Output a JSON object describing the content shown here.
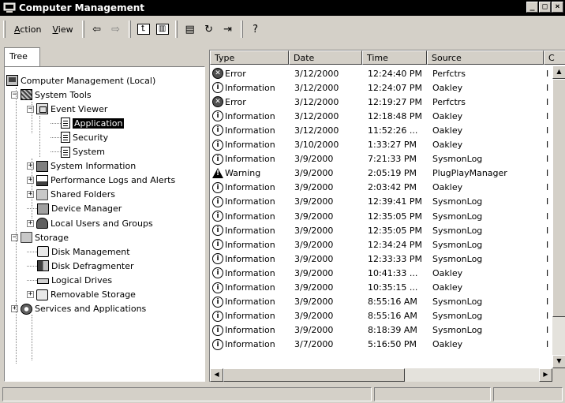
{
  "window": {
    "title": "Computer Management"
  },
  "title_buttons": [
    "_",
    "□",
    "×"
  ],
  "menu": [
    {
      "label": "Action",
      "accel": "A",
      "rest": "ction"
    },
    {
      "label": "View",
      "accel": "V",
      "rest": "iew"
    }
  ],
  "toolbar": {
    "icons": [
      "back-arrow-icon",
      "forward-arrow-icon",
      "up-folder-icon",
      "show-hide-tree-icon",
      "properties-icon",
      "refresh-icon",
      "export-list-icon",
      "help-icon"
    ],
    "glyphs": {
      "back": "⇦",
      "forward": "⇨",
      "up": "⮤",
      "tree": "▥",
      "props": "▤",
      "refresh": "↻",
      "export": "⇥",
      "help": "?"
    }
  },
  "tree": {
    "tab_label": "Tree",
    "items": [
      {
        "label": "Computer Management (Local)",
        "icon": "computer-icon",
        "expander": ""
      },
      {
        "label": "System Tools",
        "icon": "tools-icon",
        "expander": "−"
      },
      {
        "label": "Event Viewer",
        "icon": "event-viewer-icon",
        "expander": "−"
      },
      {
        "label": "Application",
        "icon": "log-icon",
        "expander": "",
        "selected": true
      },
      {
        "label": "Security",
        "icon": "log-icon",
        "expander": ""
      },
      {
        "label": "System",
        "icon": "log-icon",
        "expander": ""
      },
      {
        "label": "System Information",
        "icon": "system-info-icon",
        "expander": "+"
      },
      {
        "label": "Performance Logs and Alerts",
        "icon": "performance-icon",
        "expander": "+"
      },
      {
        "label": "Shared Folders",
        "icon": "shared-folder-icon",
        "expander": "+"
      },
      {
        "label": "Device Manager",
        "icon": "device-manager-icon",
        "expander": ""
      },
      {
        "label": "Local Users and Groups",
        "icon": "users-icon",
        "expander": "+"
      },
      {
        "label": "Storage",
        "icon": "storage-icon",
        "expander": "−"
      },
      {
        "label": "Disk Management",
        "icon": "disk-icon",
        "expander": ""
      },
      {
        "label": "Disk Defragmenter",
        "icon": "defrag-icon",
        "expander": ""
      },
      {
        "label": "Logical Drives",
        "icon": "drive-icon",
        "expander": ""
      },
      {
        "label": "Removable Storage",
        "icon": "removable-storage-icon",
        "expander": "+"
      },
      {
        "label": "Services and Applications",
        "icon": "services-icon",
        "expander": "+"
      }
    ]
  },
  "list": {
    "columns": [
      "Type",
      "Date",
      "Time",
      "Source",
      "C"
    ],
    "rows": [
      {
        "type": "Error",
        "date": "3/12/2000",
        "time": "12:24:40 PM",
        "source": "Perfctrs",
        "extra": "I"
      },
      {
        "type": "Information",
        "date": "3/12/2000",
        "time": "12:24:07 PM",
        "source": "Oakley",
        "extra": "I"
      },
      {
        "type": "Error",
        "date": "3/12/2000",
        "time": "12:19:27 PM",
        "source": "Perfctrs",
        "extra": "I"
      },
      {
        "type": "Information",
        "date": "3/12/2000",
        "time": "12:18:48 PM",
        "source": "Oakley",
        "extra": "I"
      },
      {
        "type": "Information",
        "date": "3/12/2000",
        "time": "11:52:26 ...",
        "source": "Oakley",
        "extra": "I"
      },
      {
        "type": "Information",
        "date": "3/10/2000",
        "time": "1:33:27 PM",
        "source": "Oakley",
        "extra": "I"
      },
      {
        "type": "Information",
        "date": "3/9/2000",
        "time": "7:21:33 PM",
        "source": "SysmonLog",
        "extra": "I"
      },
      {
        "type": "Warning",
        "date": "3/9/2000",
        "time": "2:05:19 PM",
        "source": "PlugPlayManager",
        "extra": "I"
      },
      {
        "type": "Information",
        "date": "3/9/2000",
        "time": "2:03:42 PM",
        "source": "Oakley",
        "extra": "I"
      },
      {
        "type": "Information",
        "date": "3/9/2000",
        "time": "12:39:41 PM",
        "source": "SysmonLog",
        "extra": "I"
      },
      {
        "type": "Information",
        "date": "3/9/2000",
        "time": "12:35:05 PM",
        "source": "SysmonLog",
        "extra": "I"
      },
      {
        "type": "Information",
        "date": "3/9/2000",
        "time": "12:35:05 PM",
        "source": "SysmonLog",
        "extra": "I"
      },
      {
        "type": "Information",
        "date": "3/9/2000",
        "time": "12:34:24 PM",
        "source": "SysmonLog",
        "extra": "I"
      },
      {
        "type": "Information",
        "date": "3/9/2000",
        "time": "12:33:33 PM",
        "source": "SysmonLog",
        "extra": "I"
      },
      {
        "type": "Information",
        "date": "3/9/2000",
        "time": "10:41:33 ...",
        "source": "Oakley",
        "extra": "I"
      },
      {
        "type": "Information",
        "date": "3/9/2000",
        "time": "10:35:15 ...",
        "source": "Oakley",
        "extra": "I"
      },
      {
        "type": "Information",
        "date": "3/9/2000",
        "time": "8:55:16 AM",
        "source": "SysmonLog",
        "extra": "I"
      },
      {
        "type": "Information",
        "date": "3/9/2000",
        "time": "8:55:16 AM",
        "source": "SysmonLog",
        "extra": "I"
      },
      {
        "type": "Information",
        "date": "3/9/2000",
        "time": "8:18:39 AM",
        "source": "SysmonLog",
        "extra": "I"
      },
      {
        "type": "Information",
        "date": "3/7/2000",
        "time": "5:16:50 PM",
        "source": "Oakley",
        "extra": "I"
      }
    ]
  },
  "severity_glyphs": {
    "Error": "✕",
    "Information": "i",
    "Warning": "!"
  },
  "scroll": {
    "up": "▲",
    "down": "▼",
    "left": "◀",
    "right": "▶"
  }
}
